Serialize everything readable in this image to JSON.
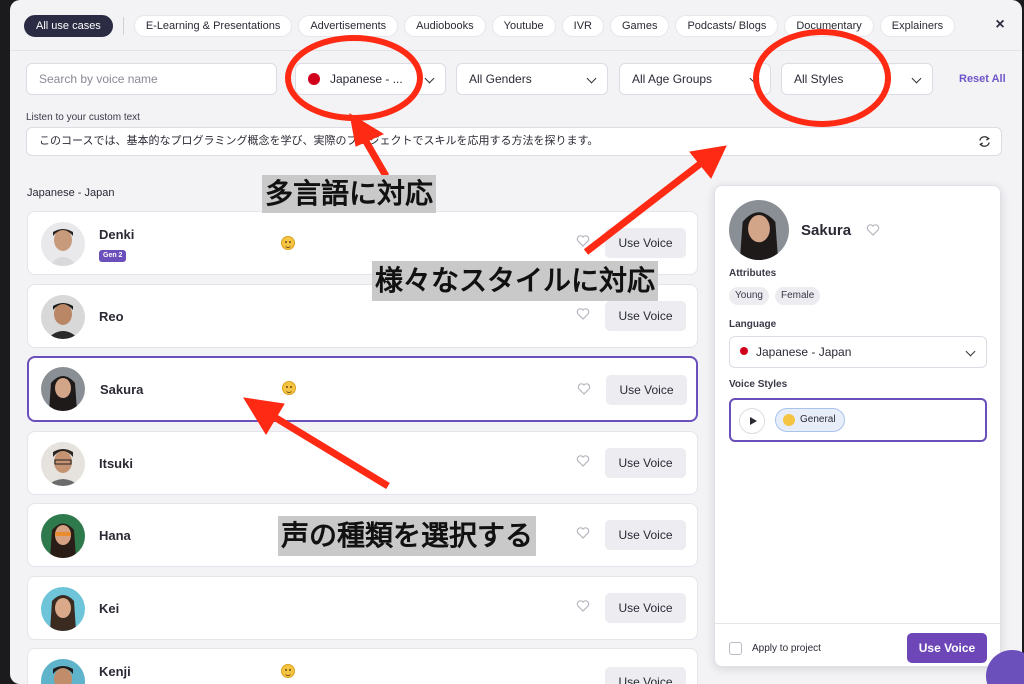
{
  "tabs": [
    "All use cases",
    "E-Learning & Presentations",
    "Advertisements",
    "Audiobooks",
    "Youtube",
    "IVR",
    "Games",
    "Podcasts/ Blogs",
    "Documentary",
    "Explainers"
  ],
  "close_icon": "×",
  "filters": {
    "search_placeholder": "Search by voice name",
    "language": "Japanese - ...",
    "gender": "All Genders",
    "age": "All Age Groups",
    "style": "All Styles",
    "reset": "Reset All"
  },
  "custom_text": {
    "label": "Listen to your custom text",
    "value": "このコースでは、基本的なプログラミング概念を学び、実際のプロジェクトでスキルを応用する方法を探ります。"
  },
  "section_label": "Japanese - Japan",
  "voices": [
    {
      "name": "Denki",
      "badge": "Gen 2",
      "emoji": true,
      "button": "Use Voice"
    },
    {
      "name": "Reo",
      "badge": "",
      "emoji": false,
      "button": "Use Voice"
    },
    {
      "name": "Sakura",
      "badge": "",
      "emoji": true,
      "button": "Use Voice"
    },
    {
      "name": "Itsuki",
      "badge": "",
      "emoji": false,
      "button": "Use Voice"
    },
    {
      "name": "Hana",
      "badge": "",
      "emoji": false,
      "button": "Use Voice"
    },
    {
      "name": "Kei",
      "badge": "",
      "emoji": false,
      "button": "Use Voice"
    },
    {
      "name": "Kenji",
      "badge": "",
      "emoji": true,
      "button": "Use Voice"
    }
  ],
  "detail": {
    "name": "Sakura",
    "attributes_label": "Attributes",
    "attributes": [
      "Young",
      "Female"
    ],
    "language_label": "Language",
    "language": "Japanese - Japan",
    "styles_label": "Voice Styles",
    "style": "General",
    "apply_label": "Apply to project",
    "use_button": "Use Voice"
  },
  "annotations": {
    "multilang": "多言語に対応",
    "styles": "様々なスタイルに対応",
    "select": "声の種類を選択する"
  },
  "colors": {
    "accent": "#6b4fbb",
    "annotation_red": "#ff2a14",
    "flag_red": "#d0021b"
  }
}
